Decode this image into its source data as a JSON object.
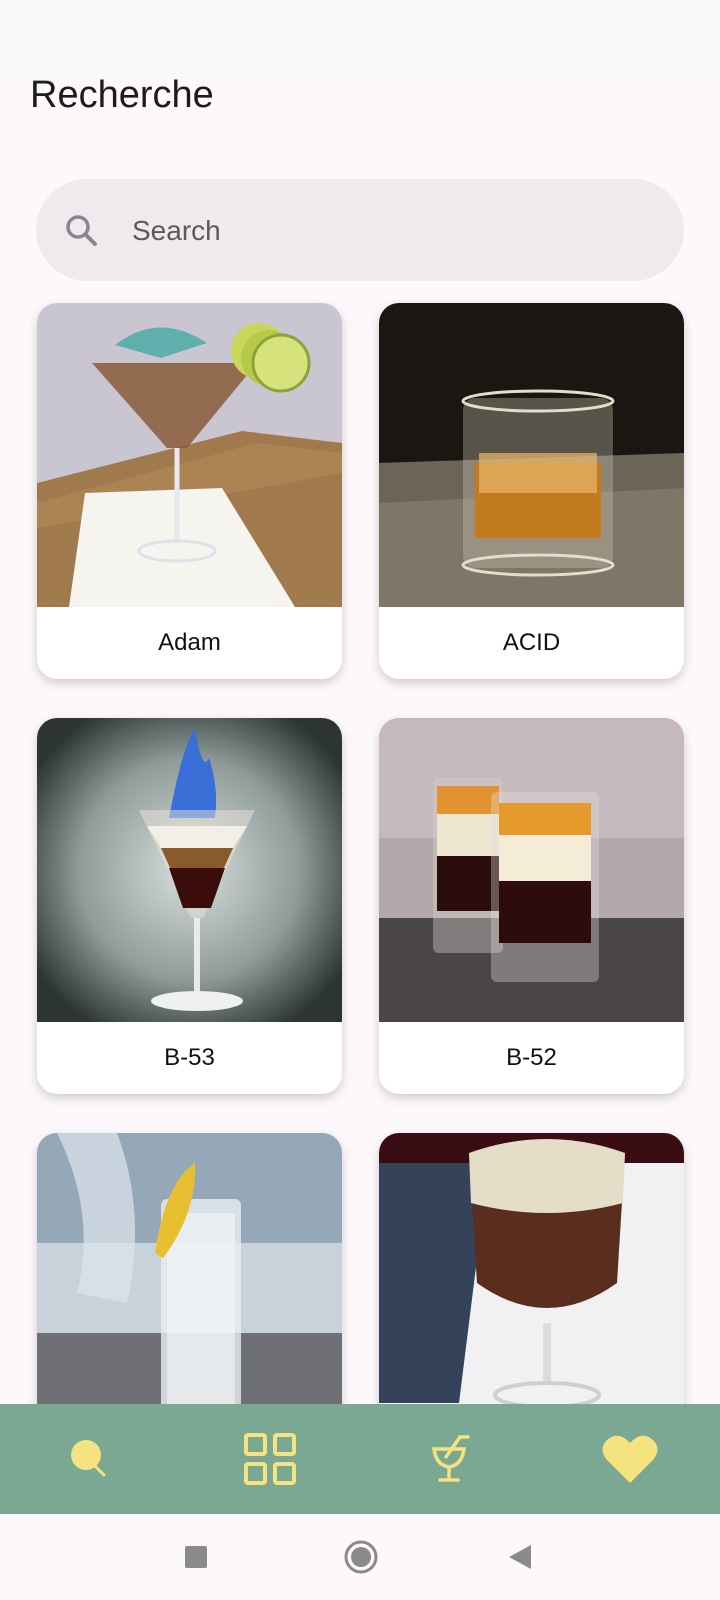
{
  "page": {
    "title": "Recherche"
  },
  "search": {
    "placeholder": "Search",
    "value": ""
  },
  "cocktails": [
    {
      "name": "Adam"
    },
    {
      "name": "ACID"
    },
    {
      "name": "B-53"
    },
    {
      "name": "B-52"
    },
    {
      "name": ""
    },
    {
      "name": ""
    }
  ],
  "bottom_nav": [
    {
      "icon": "search-icon"
    },
    {
      "icon": "grid-icon"
    },
    {
      "icon": "cocktail-icon"
    },
    {
      "icon": "heart-icon"
    }
  ],
  "colors": {
    "nav_background": "#7ba892",
    "nav_icon": "#f4e37f",
    "page_background": "#fdf8fb",
    "search_background": "#efeaed"
  }
}
